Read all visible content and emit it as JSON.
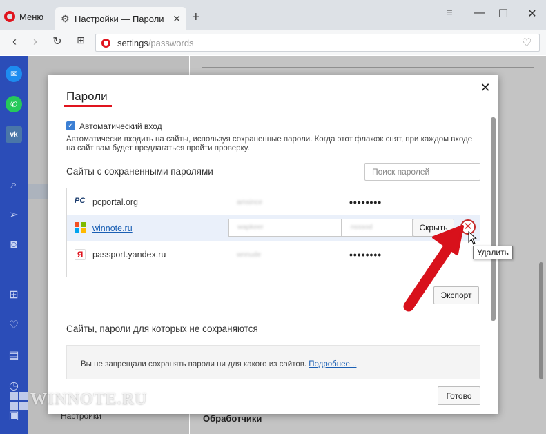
{
  "browser": {
    "menu_label": "Меню",
    "tab_title": "Настройки — Пароли",
    "url_host": "settings",
    "url_path": "/passwords"
  },
  "background": {
    "left_nav_item": "Настройки",
    "main_heading": "Обработчики"
  },
  "dialog": {
    "title": "Пароли",
    "auto_login_label": "Автоматический вход",
    "auto_login_checked": true,
    "auto_login_desc": "Автоматически входить на сайты, используя сохраненные пароли. Когда этот флажок снят, при каждом входе на сайт вам будет предлагаться пройти проверку.",
    "saved_heading": "Сайты с сохраненными паролями",
    "search_placeholder": "Поиск паролей",
    "entries": [
      {
        "site": "pcportal.org",
        "masked": "••••••••"
      },
      {
        "site": "winnote.ru",
        "show_button": "Скрыть"
      },
      {
        "site": "passport.yandex.ru",
        "masked": "••••••••"
      }
    ],
    "delete_tooltip": "Удалить",
    "export_button": "Экспорт",
    "never_heading": "Сайты, пароли для которых не сохраняются",
    "never_text": "Вы не запрещали сохранять пароли ни для какого из сайтов.",
    "never_link": "Подробнее...",
    "done_button": "Готово"
  },
  "watermark": "WINNOTE.RU",
  "colors": {
    "accent_red": "#e0141e",
    "sidebar_blue": "#2b4db8",
    "link_blue": "#1a5fb4"
  }
}
